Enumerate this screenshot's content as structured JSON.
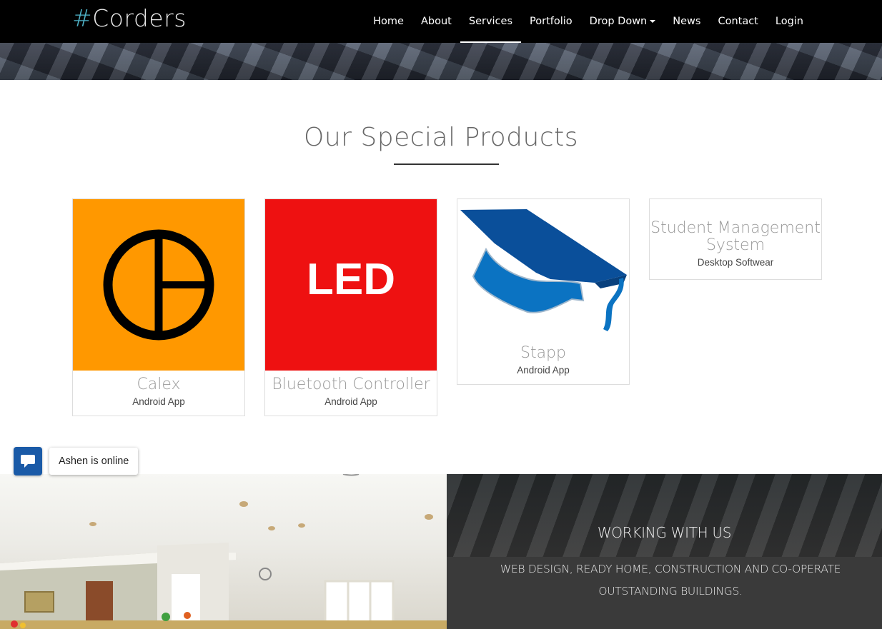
{
  "brand": {
    "hash": "#",
    "name": "Corders"
  },
  "nav": {
    "items": [
      {
        "label": "Home"
      },
      {
        "label": "About"
      },
      {
        "label": "Services"
      },
      {
        "label": "Portfolio"
      },
      {
        "label": "Drop Down"
      },
      {
        "label": "News"
      },
      {
        "label": "Contact"
      },
      {
        "label": "Login"
      }
    ],
    "active": "Services"
  },
  "section": {
    "title": "Our Special Products"
  },
  "products": [
    {
      "name": "Calex",
      "category": "Android App",
      "icon": "calex-logo-icon",
      "bg": "#ff9800"
    },
    {
      "name": "Bluetooth Controller",
      "category": "Android App",
      "icon": "led-logo-icon",
      "bg": "#ee1111",
      "logo_text": "LED"
    },
    {
      "name": "Stapp",
      "category": "Android App",
      "icon": "graduation-cap-icon"
    },
    {
      "name": "Student Management System",
      "category": "Desktop Softwear"
    }
  ],
  "chat": {
    "status": "Ashen is online",
    "icon": "chat-bubble-icon",
    "color": "#1a5aa7"
  },
  "working": {
    "title": "WORKING WITH US",
    "text": "WEB DESIGN, READY HOME, CONSTRUCTION AND CO-OPERATE OUTSTANDING BUILDINGS."
  }
}
